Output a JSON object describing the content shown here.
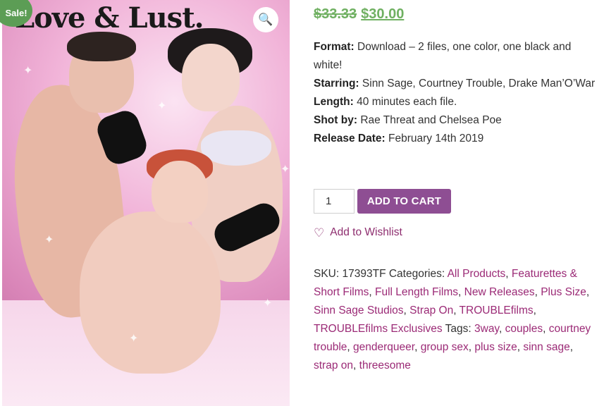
{
  "image": {
    "cover_title": "Love & Lust.",
    "sale_badge": "Sale!",
    "zoom_icon": "🔍"
  },
  "price": {
    "old": "$33.33",
    "new": "$30.00"
  },
  "details": [
    {
      "label": "Format:",
      "value": "Download – 2 files, one color, one black and white!"
    },
    {
      "label": "Starring:",
      "value": "Sinn Sage, Courtney Trouble, Drake Man’O’War"
    },
    {
      "label": "Length:",
      "value": "40 minutes each file."
    },
    {
      "label": "Shot by:",
      "value": "Rae Threat and Chelsea Poe"
    },
    {
      "label": "Release Date:",
      "value": "February 14th 2019"
    }
  ],
  "cart": {
    "quantity": "1",
    "add_label": "ADD TO CART"
  },
  "wishlist": {
    "icon": "heart-outline-icon",
    "label": "Add to Wishlist"
  },
  "meta": {
    "sku_label": "SKU:",
    "sku": "17393TF",
    "categories_label": "Categories:",
    "categories": [
      "All Products",
      "Featurettes & Short Films",
      "Full Length Films",
      "New Releases",
      "Plus Size",
      "Sinn Sage Studios",
      "Strap On",
      "TROUBLEfilms",
      "TROUBLEfilms Exclusives"
    ],
    "tags_label": "Tags:",
    "tags": [
      "3way",
      "couples",
      "courtney trouble",
      "genderqueer",
      "group sex",
      "plus size",
      "sinn sage",
      "strap on",
      "threesome"
    ]
  },
  "colors": {
    "sale_green": "#6fb061",
    "button_purple": "#8e4e93",
    "link_magenta": "#9b2a76"
  }
}
